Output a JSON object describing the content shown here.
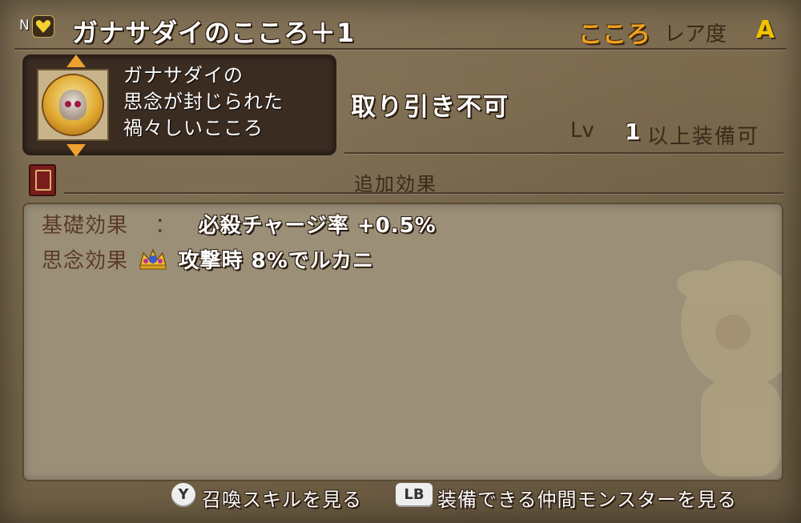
{
  "header": {
    "n_mark": "N",
    "title": "ガナサダイのこころ＋1",
    "kokoro_label": "こころ",
    "rarity_label": "レア度",
    "rarity_value": "A"
  },
  "item": {
    "description_lines": [
      "ガナサダイの",
      "思念が封じられた",
      "禍々しいこころ"
    ],
    "trade_status": "取り引き不可",
    "level_label": "Lv",
    "level_value": "1",
    "level_suffix": "以上装備可"
  },
  "extra": {
    "section_label": "追加効果",
    "effects": [
      {
        "label": "基礎効果",
        "separator": "：",
        "value": "必殺チャージ率 +0.5%"
      },
      {
        "label": "思念効果",
        "icon": "crown-icon",
        "value": "攻撃時 8%でルカニ"
      }
    ]
  },
  "footer": {
    "y_button": "Y",
    "y_label": "召喚スキルを見る",
    "lb_button": "LB",
    "lb_label": "装備できる仲間モンスターを見る"
  },
  "colors": {
    "accent_orange": "#f0a020",
    "rarity_yellow": "#f2c200",
    "panel_bg": "#7a6a4d",
    "effects_bg": "#9b8f78"
  }
}
